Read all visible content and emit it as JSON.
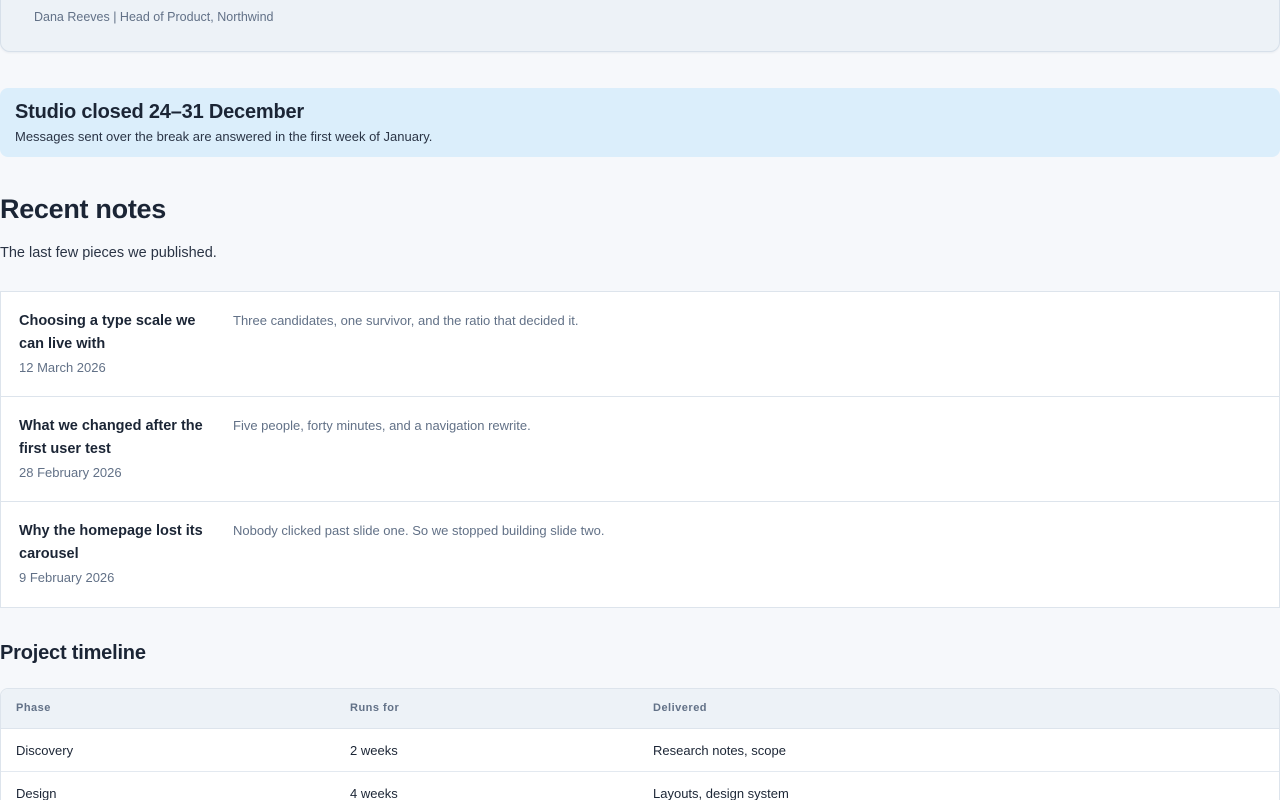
{
  "testimonial": {
    "attribution": "Dana Reeves | Head of Product, Northwind"
  },
  "notice": {
    "title": "Studio closed 24–31 December",
    "text": "Messages sent over the break are answered in the first week of January."
  },
  "recent_notes": {
    "title": "Recent notes",
    "description": "The last few pieces we published.",
    "items": [
      {
        "title": "Choosing a type scale we can live with",
        "date": "12 March 2026",
        "summary": "Three candidates, one survivor, and the ratio that decided it."
      },
      {
        "title": "What we changed after the first user test",
        "date": "28 February 2026",
        "summary": "Five people, forty minutes, and a navigation rewrite."
      },
      {
        "title": "Why the homepage lost its carousel",
        "date": "9 February 2026",
        "summary": "Nobody clicked past slide one. So we stopped building slide two."
      }
    ]
  },
  "timeline": {
    "title": "Project timeline",
    "headers": [
      "Phase",
      "Runs for",
      "Delivered"
    ],
    "rows": [
      [
        "Discovery",
        "2 weeks",
        "Research notes, scope"
      ],
      [
        "Design",
        "4 weeks",
        "Layouts, design system"
      ]
    ]
  }
}
